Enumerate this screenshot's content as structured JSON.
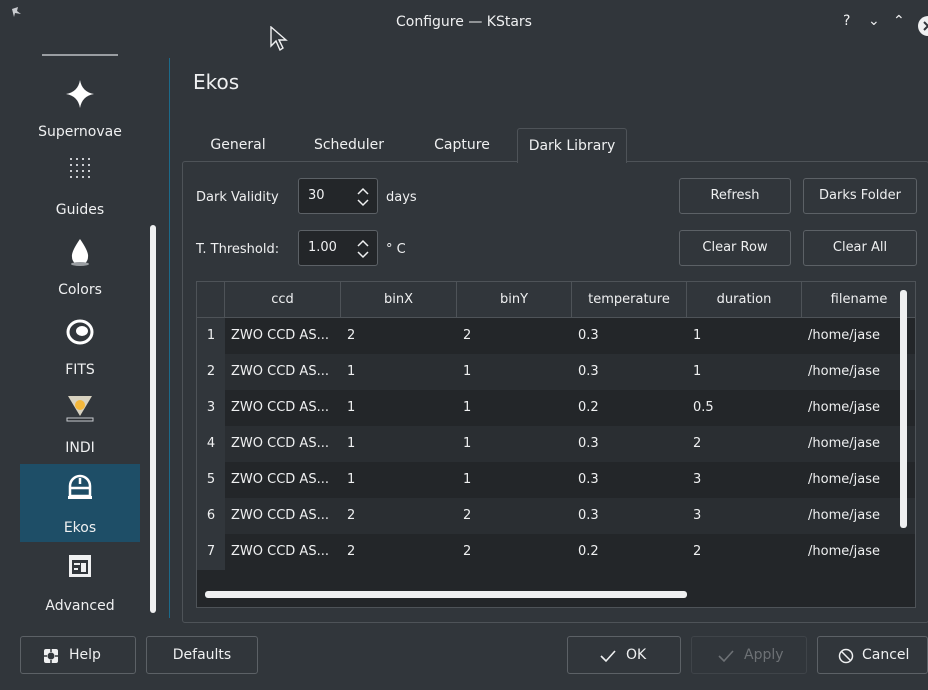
{
  "window": {
    "title": "Configure — KStars",
    "help_glyph": "?",
    "minimize_glyph": "⌄",
    "maximize_glyph": "⌃"
  },
  "colors": {
    "background": "#31363b",
    "selection": "#1e4e67",
    "view": "#232629",
    "text": "#eff0f1"
  },
  "sidebar": {
    "items": [
      {
        "label": "Supernovae",
        "icon": "star-sparkle-icon"
      },
      {
        "label": "Guides",
        "icon": "dot-grid-icon"
      },
      {
        "label": "Colors",
        "icon": "droplet-icon"
      },
      {
        "label": "FITS",
        "icon": "fits-ring-icon"
      },
      {
        "label": "INDI",
        "icon": "indi-lamp-icon"
      },
      {
        "label": "Ekos",
        "icon": "ekos-observatory-icon",
        "active": true
      },
      {
        "label": "Advanced",
        "icon": "advanced-panel-icon"
      }
    ]
  },
  "page": {
    "title": "Ekos"
  },
  "tabs": [
    {
      "label": "General"
    },
    {
      "label": "Scheduler"
    },
    {
      "label": "Capture"
    },
    {
      "label": "Dark Library",
      "active": true
    }
  ],
  "form": {
    "dark_validity_label": "Dark Validity",
    "dark_validity_value": "30",
    "dark_validity_unit": "days",
    "threshold_label": "T. Threshold:",
    "threshold_value": "1.00",
    "threshold_unit": "° C",
    "refresh": "Refresh",
    "darks_folder": "Darks Folder",
    "clear_row": "Clear Row",
    "clear_all": "Clear All"
  },
  "table": {
    "columns": [
      "ccd",
      "binX",
      "binY",
      "temperature",
      "duration",
      "filename"
    ],
    "rows": [
      {
        "n": "1",
        "cells": [
          "ZWO CCD AS...",
          "2",
          "2",
          "0.3",
          "1",
          "/home/jase"
        ]
      },
      {
        "n": "2",
        "cells": [
          "ZWO CCD AS...",
          "1",
          "1",
          "0.3",
          "1",
          "/home/jase"
        ]
      },
      {
        "n": "3",
        "cells": [
          "ZWO CCD AS...",
          "1",
          "1",
          "0.2",
          "0.5",
          "/home/jase"
        ]
      },
      {
        "n": "4",
        "cells": [
          "ZWO CCD AS...",
          "1",
          "1",
          "0.3",
          "2",
          "/home/jase"
        ]
      },
      {
        "n": "5",
        "cells": [
          "ZWO CCD AS...",
          "1",
          "1",
          "0.3",
          "3",
          "/home/jase"
        ]
      },
      {
        "n": "6",
        "cells": [
          "ZWO CCD AS...",
          "2",
          "2",
          "0.3",
          "3",
          "/home/jase"
        ]
      },
      {
        "n": "7",
        "cells": [
          "ZWO CCD AS...",
          "2",
          "2",
          "0.2",
          "2",
          "/home/jase"
        ]
      }
    ]
  },
  "footer": {
    "help": "Help",
    "defaults": "Defaults",
    "ok": "OK",
    "apply": "Apply",
    "cancel": "Cancel"
  }
}
